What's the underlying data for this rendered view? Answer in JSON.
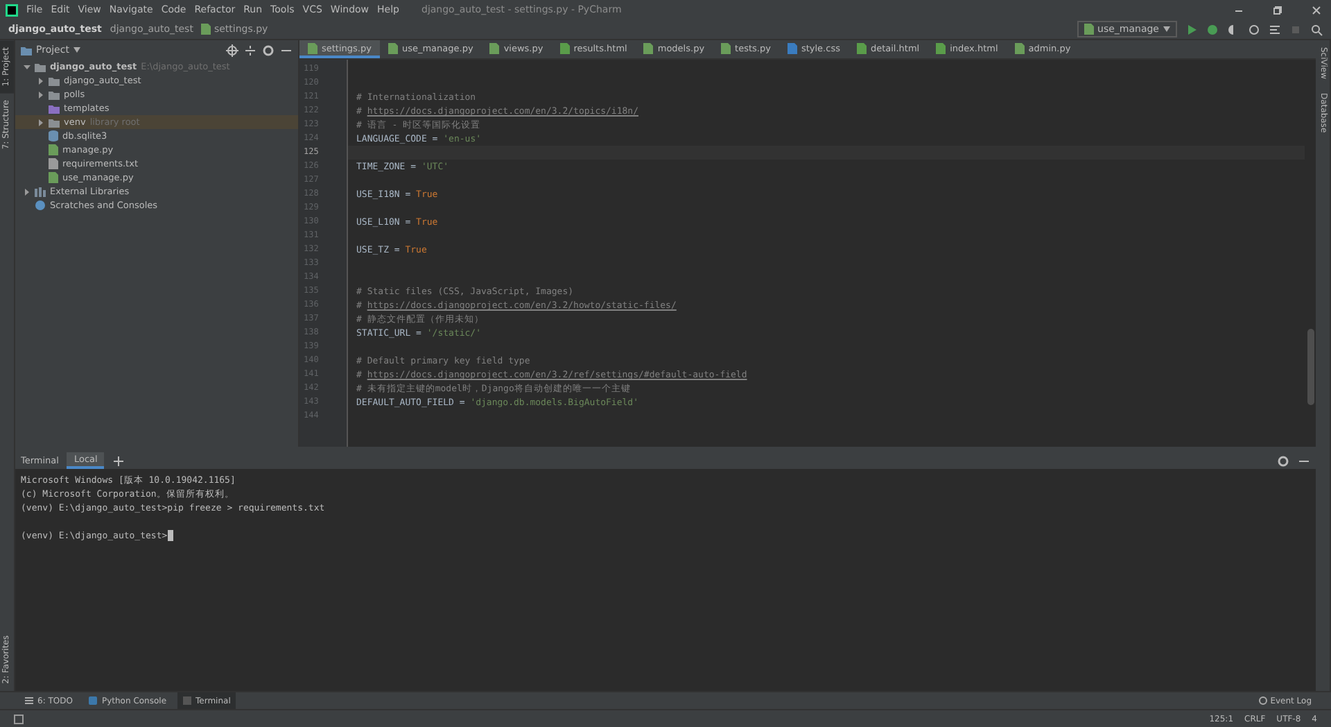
{
  "window": {
    "title": "django_auto_test - settings.py - PyCharm"
  },
  "menu": [
    "File",
    "Edit",
    "View",
    "Navigate",
    "Code",
    "Refactor",
    "Run",
    "Tools",
    "VCS",
    "Window",
    "Help"
  ],
  "breadcrumb": [
    "django_auto_test",
    "django_auto_test",
    "settings.py"
  ],
  "run_config": "use_manage",
  "left_strip": [
    {
      "label": "1: Project",
      "selected": true
    },
    {
      "label": "7: Structure",
      "selected": false
    }
  ],
  "left_strip_bottom": [
    {
      "label": "2: Favorites",
      "selected": false
    }
  ],
  "right_strip": [
    {
      "label": "SciView",
      "selected": false
    },
    {
      "label": "Database",
      "selected": false
    }
  ],
  "project": {
    "title": "Project",
    "tree": [
      {
        "label": "django_auto_test",
        "hint": "E:\\django_auto_test",
        "kind": "folder",
        "expanded": true,
        "selected": false,
        "children": [
          {
            "label": "django_auto_test",
            "kind": "folder",
            "expanded": false,
            "selected": false
          },
          {
            "label": "polls",
            "kind": "folder",
            "expanded": false,
            "selected": false
          },
          {
            "label": "templates",
            "kind": "template",
            "selected": false
          },
          {
            "label": "venv",
            "hint": "library root",
            "kind": "folder",
            "expanded": false,
            "selected": true
          },
          {
            "label": "db.sqlite3",
            "kind": "db",
            "selected": false
          },
          {
            "label": "manage.py",
            "kind": "py",
            "selected": false
          },
          {
            "label": "requirements.txt",
            "kind": "txt",
            "selected": false
          },
          {
            "label": "use_manage.py",
            "kind": "py",
            "selected": false
          }
        ]
      },
      {
        "label": "External Libraries",
        "kind": "lib",
        "expanded": false,
        "selected": false
      },
      {
        "label": "Scratches and Consoles",
        "kind": "scratch",
        "selected": false
      }
    ]
  },
  "tabs": [
    {
      "label": "settings.py",
      "kind": "py",
      "selected": true
    },
    {
      "label": "use_manage.py",
      "kind": "py",
      "selected": false
    },
    {
      "label": "views.py",
      "kind": "py",
      "selected": false
    },
    {
      "label": "results.html",
      "kind": "html",
      "selected": false
    },
    {
      "label": "models.py",
      "kind": "py",
      "selected": false
    },
    {
      "label": "tests.py",
      "kind": "py",
      "selected": false
    },
    {
      "label": "style.css",
      "kind": "css",
      "selected": false
    },
    {
      "label": "detail.html",
      "kind": "html",
      "selected": false
    },
    {
      "label": "index.html",
      "kind": "html",
      "selected": false
    },
    {
      "label": "admin.py",
      "kind": "py",
      "selected": false
    }
  ],
  "editor": {
    "lines": [
      {
        "number": "119",
        "current": false
      },
      {
        "number": "120",
        "current": false
      },
      {
        "number": "121",
        "current": false,
        "parts": [
          {
            "kind": "comment",
            "text": "# Internationalization"
          }
        ]
      },
      {
        "number": "122",
        "current": false,
        "parts": [
          {
            "kind": "comment",
            "text": "# "
          },
          {
            "kind": "link",
            "text": "https://docs.djangoproject.com/en/3.2/topics/i18n/"
          }
        ]
      },
      {
        "number": "123",
        "current": false,
        "parts": [
          {
            "kind": "comment",
            "text": "# 语言 - 时区等国际化设置"
          }
        ]
      },
      {
        "number": "124",
        "current": false,
        "parts": [
          {
            "kind": "name",
            "text": "LANGUAGE_CODE = "
          },
          {
            "kind": "string",
            "text": "'en-us'"
          }
        ]
      },
      {
        "number": "125",
        "current": true
      },
      {
        "number": "126",
        "current": false,
        "parts": [
          {
            "kind": "name",
            "text": "TIME_ZONE = "
          },
          {
            "kind": "string",
            "text": "'UTC'"
          }
        ]
      },
      {
        "number": "127",
        "current": false
      },
      {
        "number": "128",
        "current": false,
        "parts": [
          {
            "kind": "name",
            "text": "USE_I18N = "
          },
          {
            "kind": "keyword",
            "text": "True"
          }
        ]
      },
      {
        "number": "129",
        "current": false
      },
      {
        "number": "130",
        "current": false,
        "parts": [
          {
            "kind": "name",
            "text": "USE_L10N = "
          },
          {
            "kind": "keyword",
            "text": "True"
          }
        ]
      },
      {
        "number": "131",
        "current": false
      },
      {
        "number": "132",
        "current": false,
        "parts": [
          {
            "kind": "name",
            "text": "USE_TZ = "
          },
          {
            "kind": "keyword",
            "text": "True"
          }
        ]
      },
      {
        "number": "133",
        "current": false
      },
      {
        "number": "134",
        "current": false
      },
      {
        "number": "135",
        "current": false,
        "parts": [
          {
            "kind": "comment",
            "text": "# Static files (CSS, JavaScript, Images)"
          }
        ]
      },
      {
        "number": "136",
        "current": false,
        "parts": [
          {
            "kind": "comment",
            "text": "# "
          },
          {
            "kind": "link",
            "text": "https://docs.djangoproject.com/en/3.2/howto/static-files/"
          }
        ]
      },
      {
        "number": "137",
        "current": false,
        "parts": [
          {
            "kind": "comment",
            "text": "# 静态文件配置（作用未知）"
          }
        ]
      },
      {
        "number": "138",
        "current": false,
        "parts": [
          {
            "kind": "name",
            "text": "STATIC_URL = "
          },
          {
            "kind": "string",
            "text": "'/static/'"
          }
        ]
      },
      {
        "number": "139",
        "current": false
      },
      {
        "number": "140",
        "current": false,
        "parts": [
          {
            "kind": "comment",
            "text": "# Default primary key field type"
          }
        ]
      },
      {
        "number": "141",
        "current": false,
        "parts": [
          {
            "kind": "comment",
            "text": "# "
          },
          {
            "kind": "link",
            "text": "https://docs.djangoproject.com/en/3.2/ref/settings/#default-auto-field"
          }
        ]
      },
      {
        "number": "142",
        "current": false,
        "parts": [
          {
            "kind": "comment",
            "text": "# 未有指定主键的model时，Django将自动创建的唯一一个主键"
          }
        ]
      },
      {
        "number": "143",
        "current": false,
        "parts": [
          {
            "kind": "name",
            "text": "DEFAULT_AUTO_FIELD = "
          },
          {
            "kind": "string",
            "text": "'django.db.models.BigAutoField'"
          }
        ]
      },
      {
        "number": "144",
        "current": false
      }
    ]
  },
  "terminal": {
    "title": "Terminal",
    "tabs": [
      {
        "label": "Local",
        "selected": true
      }
    ],
    "blocks": [
      {
        "lines": [
          "Microsoft Windows [版本 10.0.19042.1165]",
          "(c) Microsoft Corporation。保留所有权利。",
          "(venv) E:\\django_auto_test>pip freeze > requirements.txt"
        ]
      },
      {
        "lines": [
          "(venv) E:\\django_auto_test>"
        ],
        "cursor": true
      }
    ]
  },
  "tool_tabs": [
    {
      "label": "6: TODO",
      "kind": "todo",
      "selected": false
    },
    {
      "label": "Python Console",
      "kind": "console",
      "selected": false
    },
    {
      "label": "Terminal",
      "kind": "terminal",
      "selected": true
    }
  ],
  "event_log": "Event Log",
  "status_bar": [
    "125:1",
    "CRLF",
    "UTF-8",
    "4"
  ]
}
